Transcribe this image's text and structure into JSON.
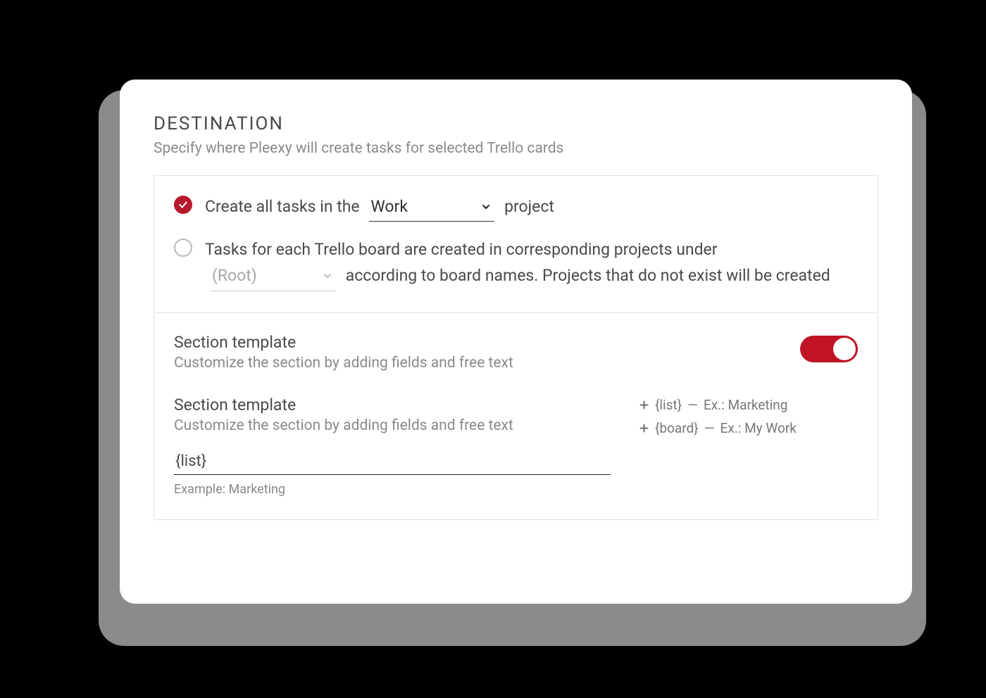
{
  "header": {
    "title": "DESTINATION",
    "subtitle": "Specify where Pleexy will create tasks for selected Trello cards"
  },
  "option1": {
    "label_prefix": "Create all tasks in the",
    "project_select_value": "Work",
    "label_suffix": "project",
    "selected": true
  },
  "option2": {
    "label_line1": "Tasks for each Trello board are created in corresponding projects under",
    "root_select_value": "(Root)",
    "label_line2": "according to board names. Projects that do not exist will be created",
    "selected": false
  },
  "section_template_toggle": {
    "title": "Section template",
    "description": "Customize the section by adding fields and free text",
    "on": true
  },
  "section_template_form": {
    "title": "Section template",
    "description": "Customize the section by adding fields and free text",
    "input_value": "{list}",
    "example_label": "Example: Marketing",
    "fields": [
      {
        "token": "{list}",
        "example": "Ex.: Marketing"
      },
      {
        "token": "{board}",
        "example": "Ex.: My Work"
      }
    ]
  }
}
